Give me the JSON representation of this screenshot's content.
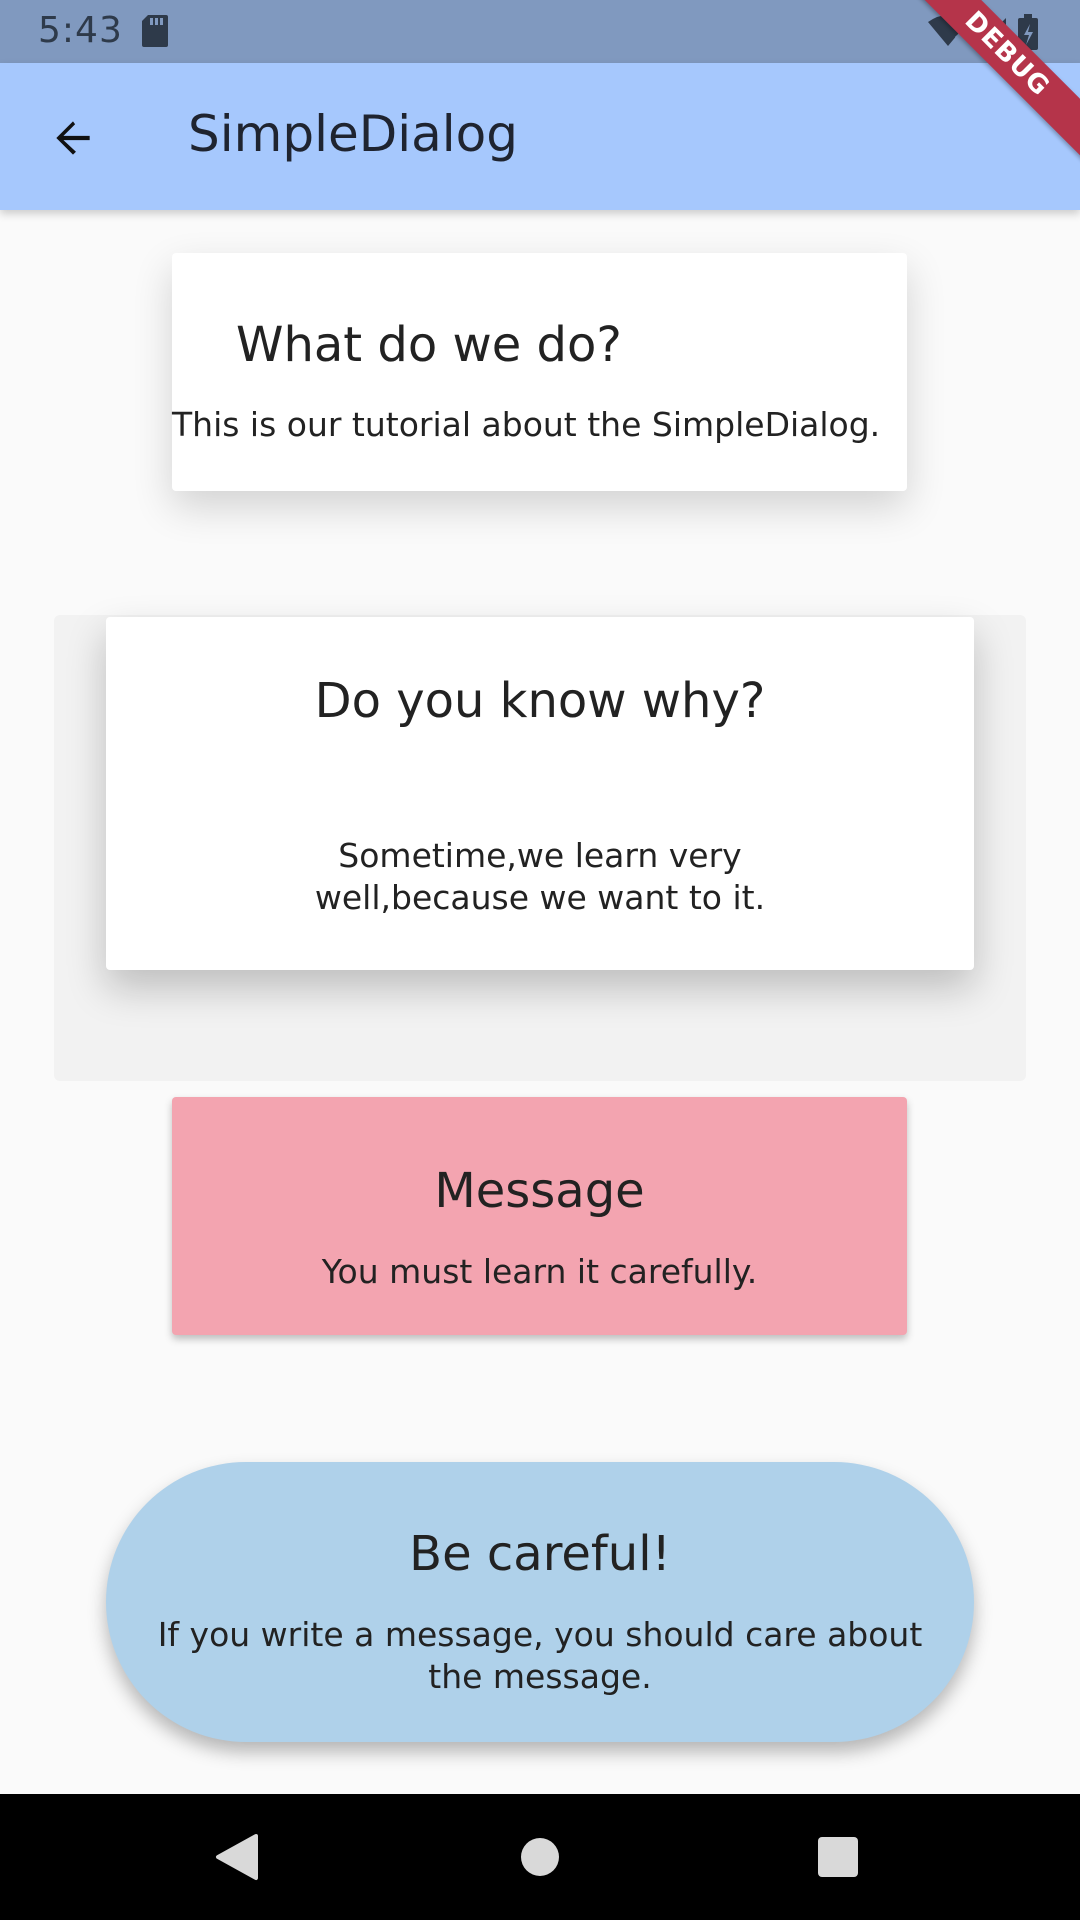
{
  "status_bar": {
    "time": "5:43",
    "icons": [
      "sd-card-icon",
      "wifi-icon",
      "signal-icon",
      "battery-icon"
    ]
  },
  "app_bar": {
    "back_icon": "arrow-back-icon",
    "title": "SimpleDialog",
    "color": "#a6c8fd"
  },
  "debug_banner": {
    "label": "DEBUG"
  },
  "cards": [
    {
      "title": "What do we do?",
      "body": "This is our tutorial about the SimpleDialog.",
      "background": "#ffffff"
    },
    {
      "title": "Do you know why?",
      "body": "Sometime,we learn very well,because we want to it.",
      "background": "#ffffff"
    },
    {
      "title": "Message",
      "body": "You must learn it carefully.",
      "background": "#f3a4b0"
    },
    {
      "title": "Be careful!",
      "body": "If you write a message, you should care about the message.",
      "background": "#afd1ea"
    }
  ],
  "nav_bar": {
    "buttons": [
      "back-triangle-icon",
      "home-circle-icon",
      "recents-square-icon"
    ]
  }
}
